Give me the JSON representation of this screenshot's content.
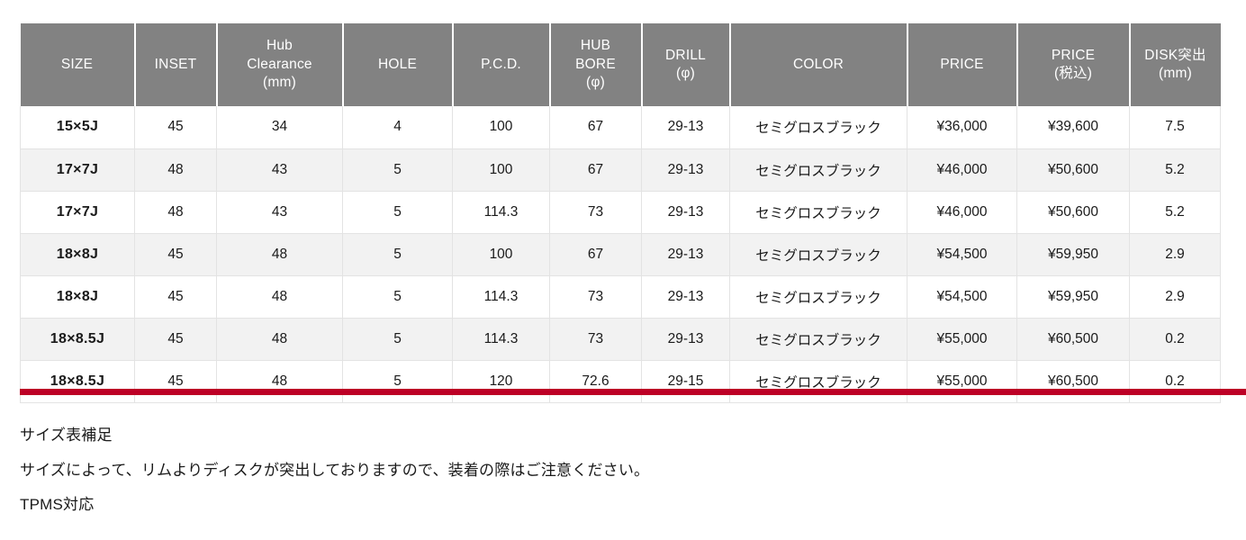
{
  "table": {
    "headers": [
      "SIZE",
      "INSET",
      "Hub\nClearance\n(mm)",
      "HOLE",
      "P.C.D.",
      "HUB\nBORE\n(φ)",
      "DRILL\n(φ)",
      "COLOR",
      "PRICE",
      "PRICE\n(税込)",
      "DISK突出\n(mm)"
    ],
    "rows": [
      {
        "size": "15×5J",
        "inset": "45",
        "hub_clearance": "34",
        "hole": "4",
        "pcd": "100",
        "hub_bore": "67",
        "drill": "29-13",
        "color": "セミグロスブラック",
        "price": "¥36,000",
        "price_tax": "¥39,600",
        "disk": "7.5"
      },
      {
        "size": "17×7J",
        "inset": "48",
        "hub_clearance": "43",
        "hole": "5",
        "pcd": "100",
        "hub_bore": "67",
        "drill": "29-13",
        "color": "セミグロスブラック",
        "price": "¥46,000",
        "price_tax": "¥50,600",
        "disk": "5.2"
      },
      {
        "size": "17×7J",
        "inset": "48",
        "hub_clearance": "43",
        "hole": "5",
        "pcd": "114.3",
        "hub_bore": "73",
        "drill": "29-13",
        "color": "セミグロスブラック",
        "price": "¥46,000",
        "price_tax": "¥50,600",
        "disk": "5.2"
      },
      {
        "size": "18×8J",
        "inset": "45",
        "hub_clearance": "48",
        "hole": "5",
        "pcd": "100",
        "hub_bore": "67",
        "drill": "29-13",
        "color": "セミグロスブラック",
        "price": "¥54,500",
        "price_tax": "¥59,950",
        "disk": "2.9"
      },
      {
        "size": "18×8J",
        "inset": "45",
        "hub_clearance": "48",
        "hole": "5",
        "pcd": "114.3",
        "hub_bore": "73",
        "drill": "29-13",
        "color": "セミグロスブラック",
        "price": "¥54,500",
        "price_tax": "¥59,950",
        "disk": "2.9"
      },
      {
        "size": "18×8.5J",
        "inset": "45",
        "hub_clearance": "48",
        "hole": "5",
        "pcd": "114.3",
        "hub_bore": "73",
        "drill": "29-13",
        "color": "セミグロスブラック",
        "price": "¥55,000",
        "price_tax": "¥60,500",
        "disk": "0.2"
      },
      {
        "size": "18×8.5J",
        "inset": "45",
        "hub_clearance": "48",
        "hole": "5",
        "pcd": "120",
        "hub_bore": "72.6",
        "drill": "29-15",
        "color": "セミグロスブラック",
        "price": "¥55,000",
        "price_tax": "¥60,500",
        "disk": "0.2"
      }
    ]
  },
  "notes": {
    "line1": "サイズ表補足",
    "line2": "サイズによって、リムよりディスクが突出しておりますので、装着の際はご注意ください。",
    "line3": "TPMS対応"
  },
  "colors": {
    "header_bg": "#828282",
    "row_alt_bg": "#f2f2f2",
    "accent_rule": "#bd0026",
    "cell_border": "#e3e3e3",
    "text": "#1a1a1a"
  }
}
